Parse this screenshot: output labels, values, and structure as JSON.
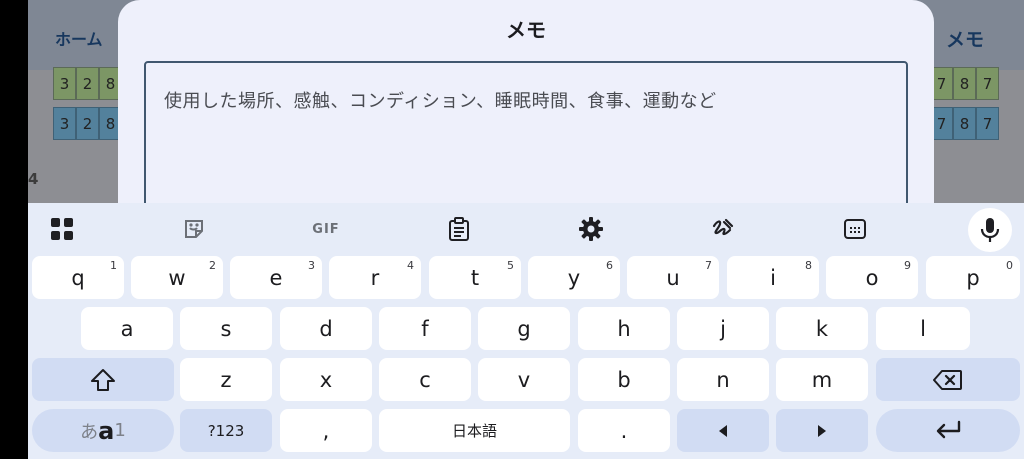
{
  "background_app": {
    "home_label": "ホーム",
    "memo_label": "メモ",
    "grid_left_row1": [
      "3",
      "2",
      "8"
    ],
    "grid_left_row2": [
      "3",
      "2",
      "8"
    ],
    "grid_right_row1": [
      "7",
      "8",
      "7"
    ],
    "grid_right_row2": [
      "7",
      "8",
      "7"
    ],
    "section_number": "4"
  },
  "dialog": {
    "title": "メモ",
    "placeholder": "使用した場所、感触、コンディション、睡眠時間、食事、運動など"
  },
  "keyboard": {
    "toolbar": {
      "gif_label": "GIF",
      "icons": [
        "apps-grid-icon",
        "sticker-icon",
        "gif-icon",
        "clipboard-icon",
        "settings-gear-icon",
        "handwriting-icon",
        "floating-keyboard-icon",
        "microphone-icon"
      ]
    },
    "row1": [
      {
        "label": "q",
        "hint": "1"
      },
      {
        "label": "w",
        "hint": "2"
      },
      {
        "label": "e",
        "hint": "3"
      },
      {
        "label": "r",
        "hint": "4"
      },
      {
        "label": "t",
        "hint": "5"
      },
      {
        "label": "y",
        "hint": "6"
      },
      {
        "label": "u",
        "hint": "7"
      },
      {
        "label": "i",
        "hint": "8"
      },
      {
        "label": "o",
        "hint": "9"
      },
      {
        "label": "p",
        "hint": "0"
      }
    ],
    "row2": [
      "a",
      "s",
      "d",
      "f",
      "g",
      "h",
      "j",
      "k",
      "l"
    ],
    "row3": [
      "z",
      "x",
      "c",
      "v",
      "b",
      "n",
      "m"
    ],
    "symbols_label": "?123",
    "comma_label": ",",
    "space_label": "日本語",
    "period_label": ".",
    "lang_switch": {
      "kana": "あ",
      "latin": "a",
      "num": "1"
    },
    "accent_color": "#1a73e8"
  }
}
